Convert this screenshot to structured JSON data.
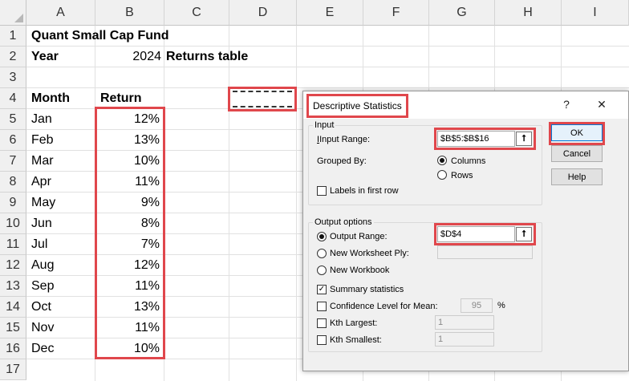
{
  "columns": [
    "A",
    "B",
    "C",
    "D",
    "E",
    "F",
    "G",
    "H",
    "I"
  ],
  "rows": [
    "1",
    "2",
    "3",
    "4",
    "5",
    "6",
    "7",
    "8",
    "9",
    "10",
    "11",
    "12",
    "13",
    "14",
    "15",
    "16",
    "17"
  ],
  "sheet": {
    "a1": "Quant Small Cap Fund",
    "a2": "Year",
    "b2": "2024",
    "c2": "Returns table",
    "a4": "Month",
    "b4": "Return",
    "data": [
      {
        "month": "Jan",
        "ret": "12%"
      },
      {
        "month": "Feb",
        "ret": "13%"
      },
      {
        "month": "Mar",
        "ret": "10%"
      },
      {
        "month": "Apr",
        "ret": "11%"
      },
      {
        "month": "May",
        "ret": "9%"
      },
      {
        "month": "Jun",
        "ret": "8%"
      },
      {
        "month": "Jul",
        "ret": "7%"
      },
      {
        "month": "Aug",
        "ret": "12%"
      },
      {
        "month": "Sep",
        "ret": "11%"
      },
      {
        "month": "Oct",
        "ret": "13%"
      },
      {
        "month": "Nov",
        "ret": "11%"
      },
      {
        "month": "Dec",
        "ret": "10%"
      }
    ]
  },
  "dialog": {
    "title": "Descriptive Statistics",
    "help_glyph": "?",
    "close_glyph": "✕",
    "input_group": "Input",
    "input_range_label": "Input Range:",
    "input_range_value": "$B$5:$B$16",
    "grouped_by_label": "Grouped By:",
    "columns_label": "Columns",
    "rows_label": "Rows",
    "labels_first_row": "Labels in first row",
    "output_group": "Output options",
    "output_range_label": "Output Range:",
    "output_range_value": "$D$4",
    "new_ply_label": "New Worksheet Ply:",
    "new_workbook_label": "New Workbook",
    "summary_stats": "Summary statistics",
    "confidence_label": "Confidence Level for Mean:",
    "confidence_value": "95",
    "percent": "%",
    "kth_largest_label": "Kth Largest:",
    "kth_largest_value": "1",
    "kth_smallest_label": "Kth Smallest:",
    "kth_smallest_value": "1",
    "ok": "OK",
    "cancel": "Cancel",
    "help": "Help",
    "ref_glyph": "⭡",
    "check_glyph": "✓"
  },
  "colors": {
    "highlight": "#e0474c",
    "default_button": "#0078d7"
  }
}
